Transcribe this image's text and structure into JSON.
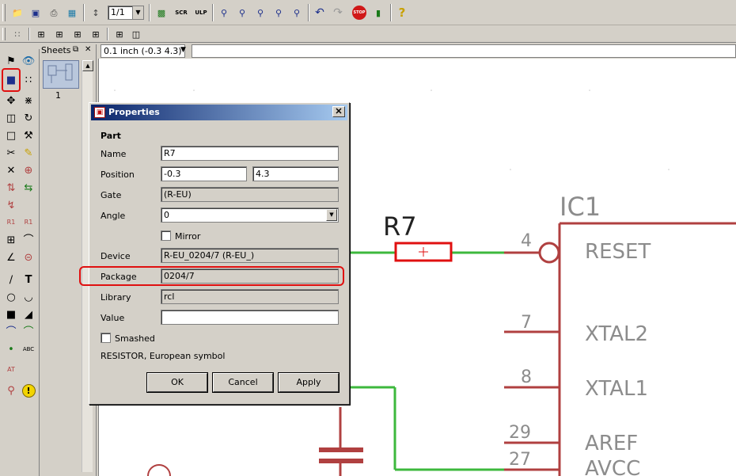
{
  "toolbar": {
    "zoom_select_value": "1/1",
    "icons": [
      "open-icon",
      "save-icon",
      "print-icon",
      "cam-icon",
      "zoom-select-icon",
      "script-icon",
      "ulp-icon",
      "zoom-fit-icon",
      "zoom-in-icon",
      "zoom-out-icon",
      "zoom-redraw-icon",
      "zoom-area-icon",
      "undo-icon",
      "redo-icon",
      "stop-icon",
      "go-icon",
      "help-icon"
    ],
    "labels": {
      "script": "SCR",
      "ulp": "ULP",
      "stop": "STOP",
      "help": "?"
    }
  },
  "sheets_panel": {
    "title": "Sheets",
    "sheet_number": "1"
  },
  "coord_display": "0.1 inch (-0.3 4.3)",
  "schematic": {
    "part_label": "R7",
    "ic_label": "IC1",
    "pins": [
      {
        "number": "4",
        "name": "RESET"
      },
      {
        "number": "7",
        "name": "XTAL2"
      },
      {
        "number": "8",
        "name": "XTAL1"
      },
      {
        "number": "29",
        "name": "AREF"
      },
      {
        "number": "27",
        "name": "AVCC"
      }
    ],
    "colors": {
      "wire": "#3db83d",
      "part": "#b04040",
      "text": "#8c8c8c",
      "highlight": "#e01010"
    }
  },
  "dialog": {
    "title": "Properties",
    "section": "Part",
    "name_label": "Name",
    "name_value": "R7",
    "position_label": "Position",
    "position_x": "-0.3",
    "position_y": "4.3",
    "gate_label": "Gate",
    "gate_value": "(R-EU)",
    "angle_label": "Angle",
    "angle_value": "0",
    "mirror_label": "Mirror",
    "device_label": "Device",
    "device_value": "R-EU_0204/7 (R-EU_)",
    "package_label": "Package",
    "package_value": "0204/7",
    "library_label": "Library",
    "library_value": "rcl",
    "value_label": "Value",
    "value_value": "",
    "smashed_label": "Smashed",
    "description": "RESISTOR, European symbol",
    "ok_label": "OK",
    "cancel_label": "Cancel",
    "apply_label": "Apply"
  }
}
